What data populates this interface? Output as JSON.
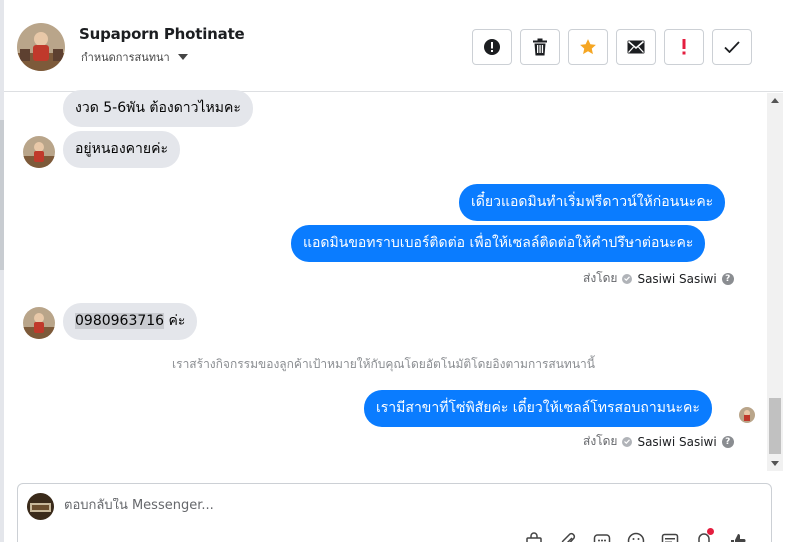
{
  "header": {
    "contact_name": "Supaporn Photinate",
    "assign_label": "กำหนดการสนทนา",
    "actions": [
      {
        "name": "mark-spam-button",
        "icon": "alert-circle-icon"
      },
      {
        "name": "delete-button",
        "icon": "trash-icon"
      },
      {
        "name": "star-button",
        "icon": "star-icon"
      },
      {
        "name": "mark-unread-button",
        "icon": "envelope-icon"
      },
      {
        "name": "follow-up-button",
        "icon": "exclamation-icon"
      },
      {
        "name": "mark-done-button",
        "icon": "checkmark-icon"
      }
    ]
  },
  "conversation": {
    "in_msg_1": "งวด 5-6พัน ต้องดาวไหมคะ",
    "in_msg_2": "อยู่หนองคายค่ะ",
    "out_msg_1": "เดี๋ยวแอดมินทำเริ่มฟรีดาวน์ให้ก่อนนะคะ",
    "out_msg_2": "แอดมินขอทราบเบอร์ติดต่อ เพื่อให้เซลล์ติดต่อให้คำปรึษาต่อนะคะ",
    "sent_by_label": "ส่งโดย",
    "sent_by_name": "Sasiwi Sasiwi",
    "phone_number": "0980963716",
    "phone_suffix": " ค่ะ",
    "system_note": "เราสร้างกิจกรรมของลูกค้าเป้าหมายให้กับคุณโดยอัตโนมัติโดยอิงตามการสนทนานี้",
    "out_msg_3": "เรามีสาขาที่โซ่พิสัยค่ะ เดี๋ยวให้เซลล์โทรสอบถามนะคะ",
    "sent_by_label_2": "ส่งโดย",
    "sent_by_name_2": "Sasiwi Sasiwi"
  },
  "composer": {
    "placeholder": "ตอบกลับใน Messenger...",
    "tools": [
      "bag-icon",
      "paperclip-icon",
      "saved-reply-icon",
      "emoji-icon",
      "template-icon",
      "notification-icon",
      "like-icon"
    ]
  },
  "colors": {
    "outgoing_bubble": "#0a7cff",
    "incoming_bubble": "#e4e6eb",
    "star": "#f5a623",
    "follow_up": "#e41e3f"
  }
}
